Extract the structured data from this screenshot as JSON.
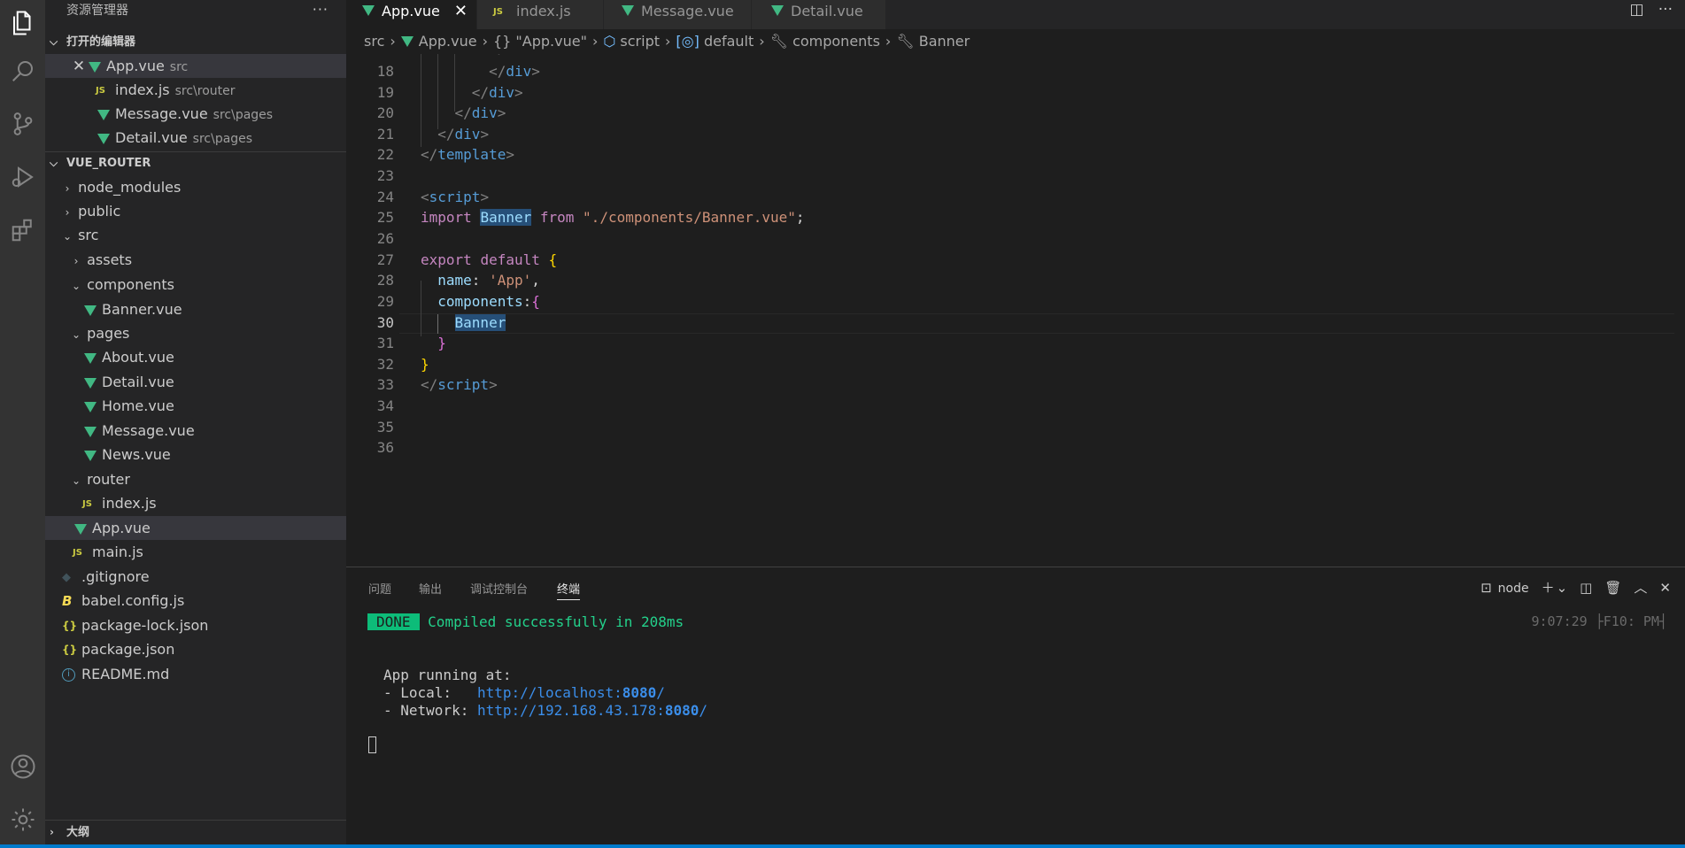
{
  "sidebar": {
    "title": "资源管理器",
    "more": "···",
    "open_editors": {
      "header": "打开的编辑器",
      "items": [
        {
          "name": "App.vue",
          "desc": "src"
        },
        {
          "name": "index.js",
          "desc": "src\\router"
        },
        {
          "name": "Message.vue",
          "desc": "src\\pages"
        },
        {
          "name": "Detail.vue",
          "desc": "src\\pages"
        }
      ]
    },
    "project": {
      "header": "VUE_ROUTER",
      "tree": [
        "node_modules",
        "public",
        "src",
        "assets",
        "components",
        "Banner.vue",
        "pages",
        "About.vue",
        "Detail.vue",
        "Home.vue",
        "Message.vue",
        "News.vue",
        "router",
        "index.js",
        "App.vue",
        "main.js",
        ".gitignore",
        "babel.config.js",
        "package-lock.json",
        "package.json",
        "README.md"
      ]
    },
    "outline_header": "大纲"
  },
  "tabs": [
    {
      "label": "App.vue",
      "active": true
    },
    {
      "label": "index.js"
    },
    {
      "label": "Message.vue"
    },
    {
      "label": "Detail.vue"
    }
  ],
  "breadcrumb": [
    "src",
    "App.vue",
    "{} \"App.vue\"",
    "script",
    "default",
    "components",
    "Banner"
  ],
  "editor": {
    "line_numbers": [
      "18",
      "19",
      "20",
      "21",
      "22",
      "23",
      "24",
      "25",
      "26",
      "27",
      "28",
      "29",
      "30",
      "31",
      "32",
      "33",
      "34",
      "35",
      "36"
    ],
    "current_line": "30"
  },
  "panel": {
    "tabs": [
      "问题",
      "输出",
      "调试控制台",
      "终端"
    ],
    "active_tab": "终端",
    "terminal_name": "node",
    "terminal": {
      "done": "DONE",
      "compiled": "Compiled successfully in 208ms",
      "timestamp": "9:07:29 ├F10: PM┤",
      "running": "App running at:",
      "local_label": "- Local:   ",
      "local_url_a": "http://localhost:",
      "local_port": "8080",
      "local_url_b": "/",
      "network_label": "- Network: ",
      "network_url_a": "http://192.168.43.178:",
      "network_port": "8080",
      "network_url_b": "/"
    }
  },
  "colors": {
    "accent": "#007acc",
    "vue_green": "#41b883",
    "done_green": "#0dbc79"
  }
}
